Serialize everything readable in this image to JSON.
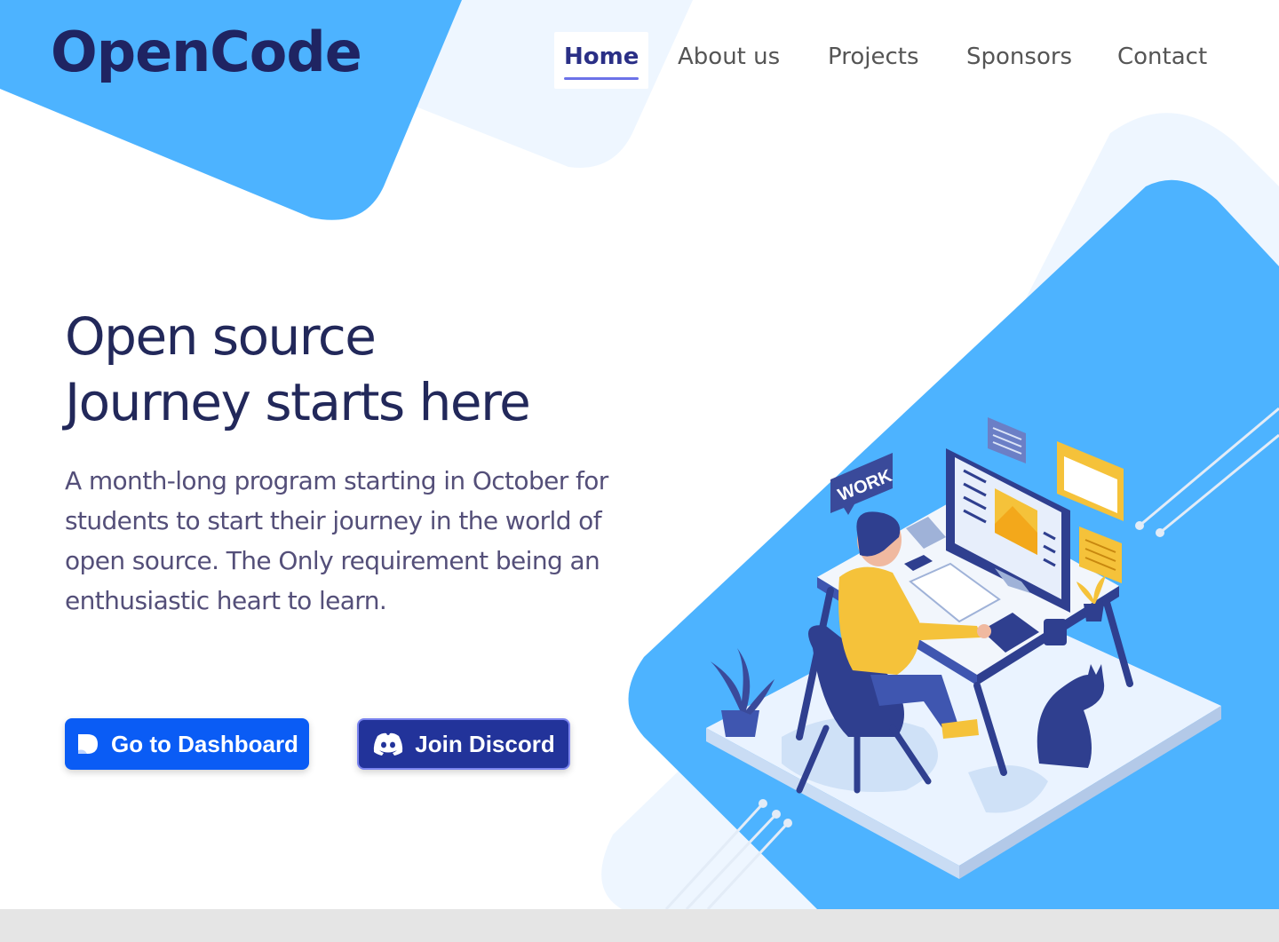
{
  "brand": {
    "logo_text": "OpenCode"
  },
  "nav": {
    "items": [
      {
        "label": "Home",
        "active": true
      },
      {
        "label": "About us",
        "active": false
      },
      {
        "label": "Projects",
        "active": false
      },
      {
        "label": "Sponsors",
        "active": false
      },
      {
        "label": "Contact",
        "active": false
      }
    ]
  },
  "hero": {
    "title_line1": "Open source",
    "title_line2": "Journey starts here",
    "description": "A month-long program starting in October for students to start their journey in the world of open source. The Only requirement being an enthusiastic heart to learn.",
    "buttons": {
      "dashboard": {
        "label": "Go to Dashboard",
        "icon": "dashboard-logo-icon"
      },
      "discord": {
        "label": "Join Discord",
        "icon": "discord-icon"
      }
    }
  },
  "illustration": {
    "sign_text": "WORK"
  },
  "colors": {
    "brand_dark": "#1f2462",
    "accent_blue": "#4db3ff",
    "light_blue": "#eef6ff",
    "primary_button": "#0a5cf5",
    "discord_button": "#22339a"
  }
}
